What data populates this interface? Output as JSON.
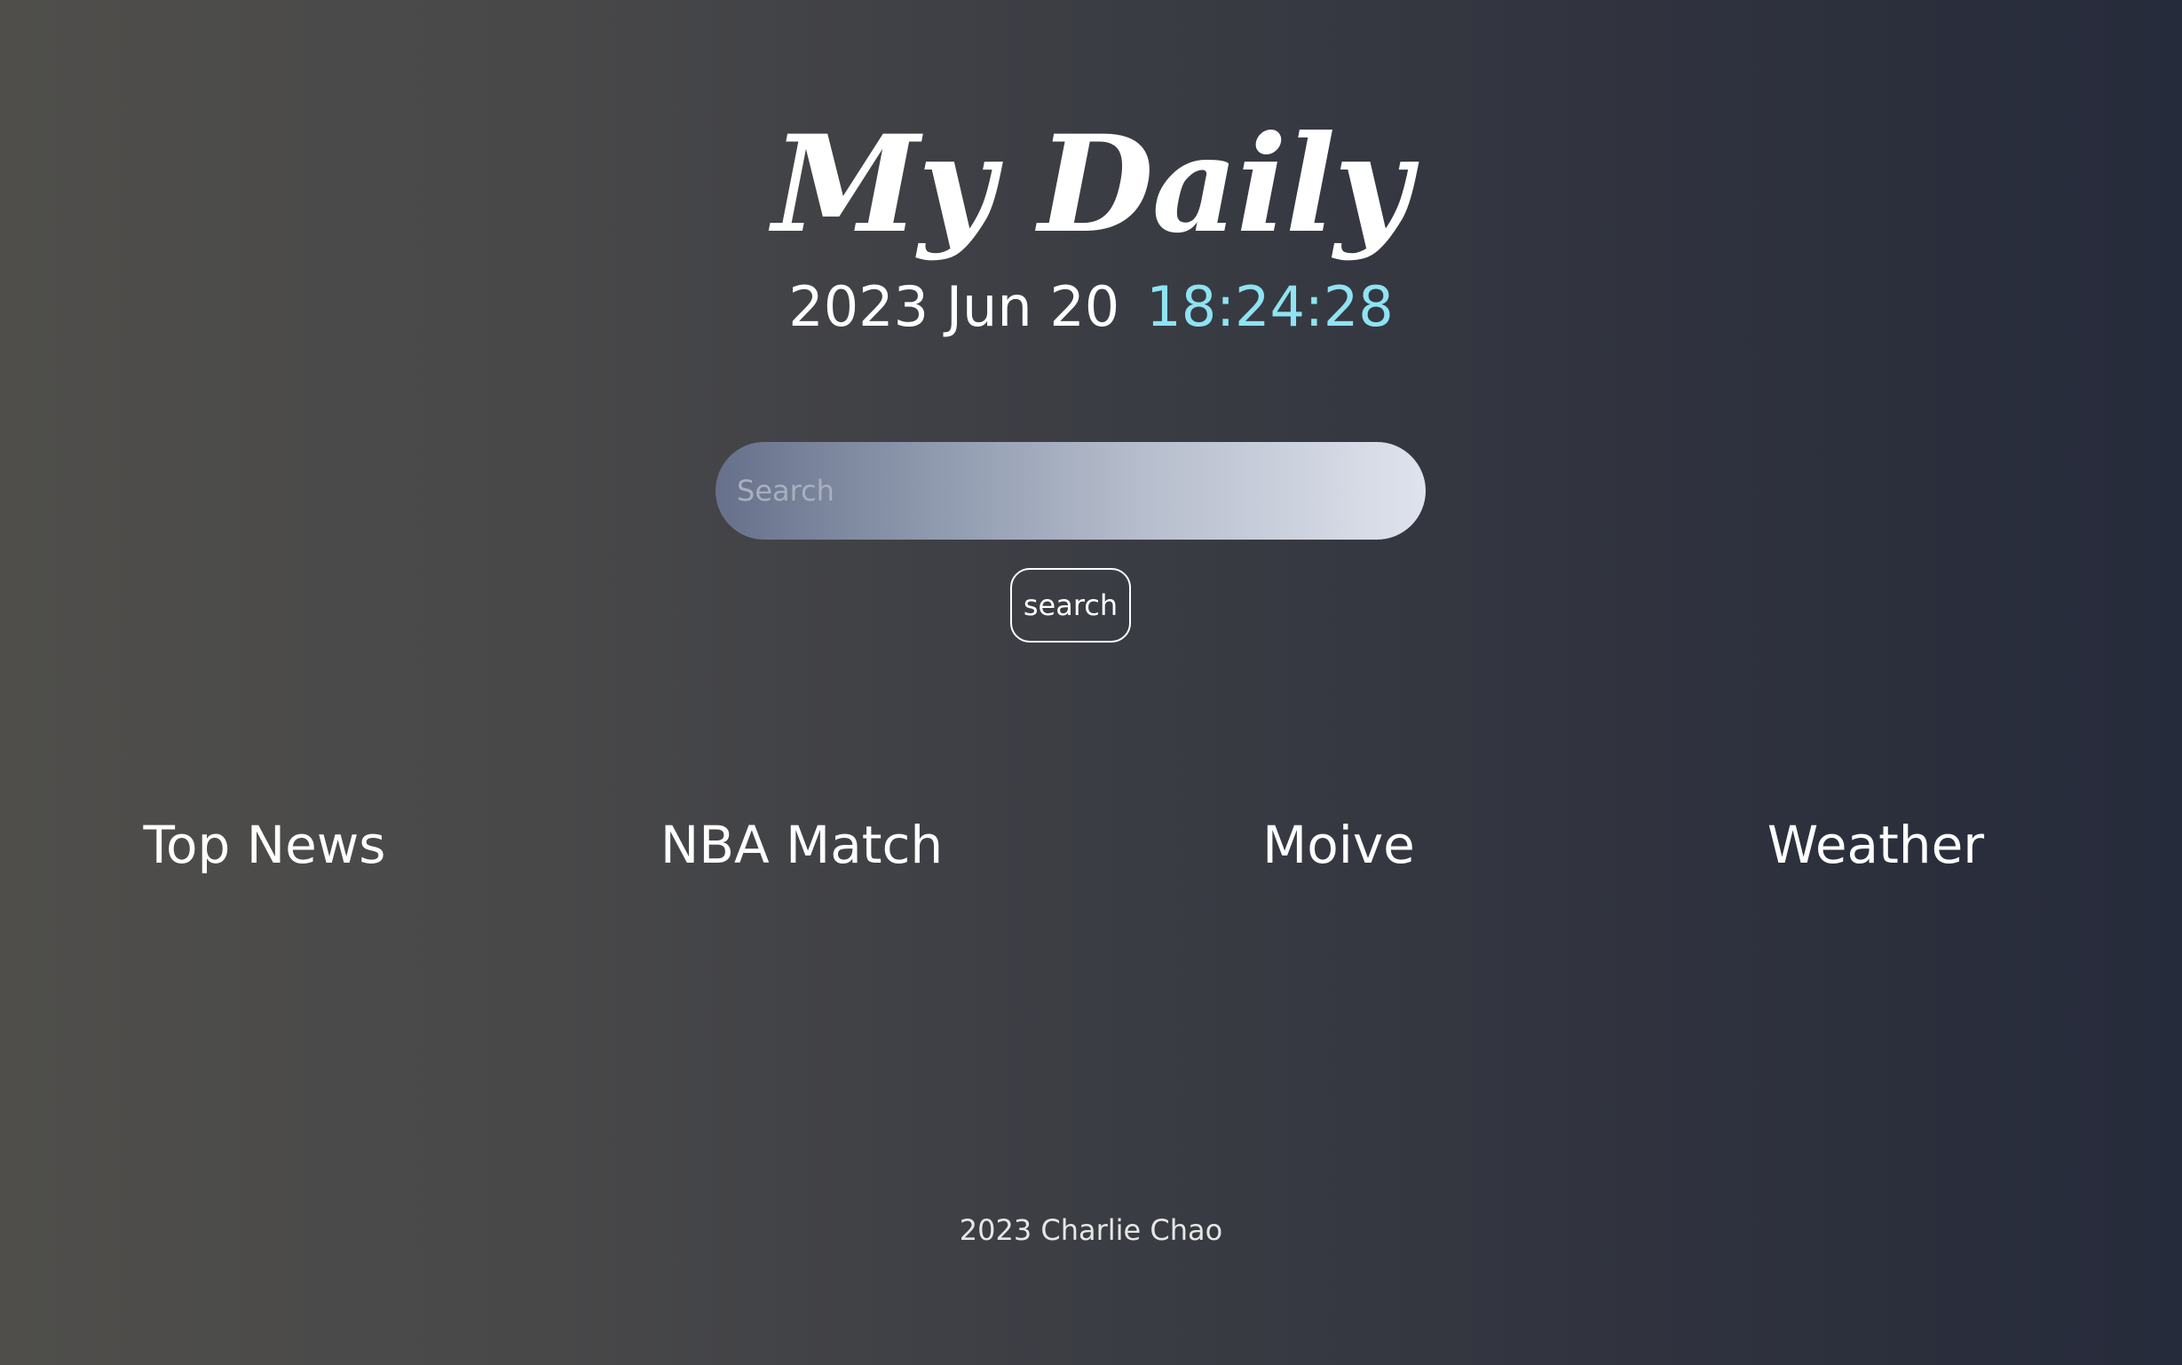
{
  "header": {
    "title": "My Daily",
    "date": "2023 Jun 20",
    "time": "18:24:28"
  },
  "search": {
    "placeholder": "Search",
    "value": "",
    "button_label": "search"
  },
  "nav": {
    "items": [
      {
        "label": "Top News"
      },
      {
        "label": "NBA Match"
      },
      {
        "label": "Moive"
      },
      {
        "label": "Weather"
      }
    ]
  },
  "footer": {
    "text": "2023 Charlie Chao"
  },
  "colors": {
    "time_accent": "#8fe3f2",
    "background_left": "#4f4e4b",
    "background_right": "#262b3b"
  }
}
